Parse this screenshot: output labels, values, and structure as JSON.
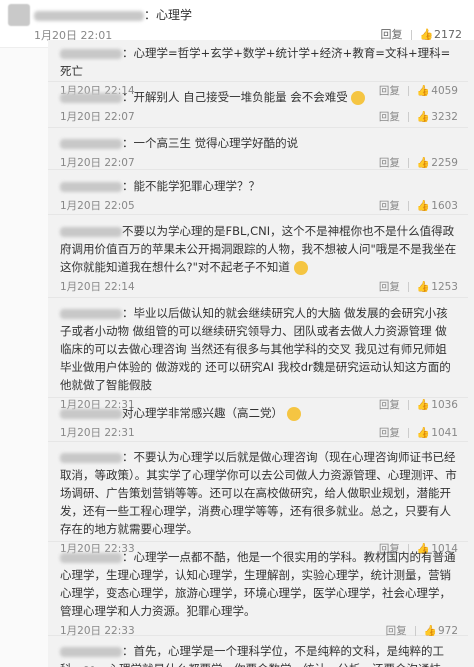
{
  "top_comment": {
    "text": "：心理学",
    "timestamp": "1月20日 22:01",
    "reply_label": "回复",
    "likes": "2172"
  },
  "replies": [
    {
      "text": "：心理学=哲学+玄学+数学+统计学+经济+教育=文科+理科=死亡",
      "timestamp": "1月20日 22:14",
      "reply_label": "回复",
      "likes": "4059"
    },
    {
      "text": "：开解别人 自己接受一堆负能量 会不会难受",
      "timestamp": "1月20日 22:07",
      "reply_label": "回复",
      "likes": "3232"
    },
    {
      "text": "：一个高三生 觉得心理学好酷的说",
      "timestamp": "1月20日 22:07",
      "reply_label": "回复",
      "likes": "2259"
    },
    {
      "text": "：能不能学犯罪心理学？？",
      "timestamp": "1月20日 22:05",
      "reply_label": "回复",
      "likes": "1603"
    },
    {
      "text": "不要以为学心理的是FBL,CNI，这个不是神棍你也不是什么值得政府调用价值百万的苹果未公开揭洞跟踪的人物，我不想被人问\"哦是不是我坐在这你就能知道我在想什么?\"对不起老子不知道",
      "timestamp": "1月20日 22:14",
      "reply_label": "回复",
      "likes": "1253"
    },
    {
      "text": "：毕业以后做认知的就会继续研究人的大脑 做发展的会研究小孩子或者小动物 做组管的可以继续研究领导力、团队或者去做人力资源管理 做临床的可以去做心理咨询 当然还有很多与其他学科的交叉 我见过有师兄师姐毕业做用户体验的 做游戏的 还可以研究AI 我校dr魏是研究运动认知这方面的 他就做了智能假肢",
      "timestamp": "1月20日 22:31",
      "reply_label": "回复",
      "likes": "1036"
    },
    {
      "text": "对心理学非常感兴趣（高二党）",
      "timestamp": "1月20日 22:31",
      "reply_label": "回复",
      "likes": "1041"
    },
    {
      "text": "：不要认为心理学以后就是做心理咨询（现在心理咨询师证书已经取消，等政策）。其实学了心理学你可以去公司做人力资源管理、心理测评、市场调研、广告策划营销等等。还可以在高校做研究，给人做职业规划，潜能开发，还有一些工程心理学，消费心理学等等，还有很多就业。总之，只要有人存在的地方就需要心理学。",
      "timestamp": "1月20日 22:33",
      "reply_label": "回复",
      "likes": "1014"
    },
    {
      "text": "：心理学一点都不酷，他是一个很实用的学科。教材国内的有普通心理学，生理心理学，认知心理学，生理解剖，实验心理学，统计测量，营销心理学，变态心理学，旅游心理学，环境心理学，医学心理学，社会心理学，管理心理学和人力资源。犯罪心理学。",
      "timestamp": "1月20日 22:33",
      "reply_label": "回复",
      "likes": "972"
    },
    {
      "text": "：首先，心理学是一个理科学位，不是纯粹的文科，是纯粹的工科，so，心理学就是什么都要学，你要会数学、统计、分析，还要会沟通技巧、观察、理论杂学等",
      "timestamp": "",
      "reply_label": "",
      "likes": ""
    }
  ]
}
